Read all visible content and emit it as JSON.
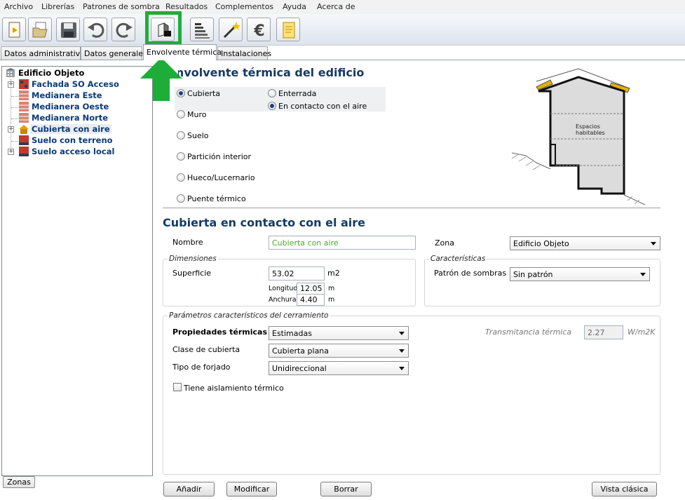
{
  "menu": [
    "Archivo",
    "Librerías",
    "Patrones de sombra",
    "Resultados",
    "Complementos",
    "Ayuda",
    "Acerca de"
  ],
  "toolbar": {
    "buttons": [
      "new-document-icon",
      "open-folder-icon",
      "save-disk-icon",
      "undo-icon",
      "redo-icon",
      "building-envelope-icon",
      "energy-rating-icon",
      "magic-wand-icon",
      "euro-icon",
      "report-icon"
    ],
    "highlight_color": "#1fad3a"
  },
  "tabs": [
    "Datos administrativos",
    "Datos generales",
    "Envolvente térmica",
    "Instalaciones"
  ],
  "tree": {
    "root": "Edificio Objeto",
    "items": [
      {
        "label": "Fachada SO Acceso",
        "icon": "facade-icon",
        "expandable": true
      },
      {
        "label": "Medianera Este",
        "icon": "party-wall-icon",
        "expandable": false
      },
      {
        "label": "Medianera Oeste",
        "icon": "party-wall-icon",
        "expandable": false
      },
      {
        "label": "Medianera Norte",
        "icon": "party-wall-icon",
        "expandable": false
      },
      {
        "label": "Cubierta con aire",
        "icon": "roof-icon",
        "expandable": true
      },
      {
        "label": "Suelo con terreno",
        "icon": "floor-icon",
        "expandable": false
      },
      {
        "label": "Suelo acceso local",
        "icon": "floor-icon",
        "expandable": true
      }
    ],
    "zonas_button": "Zonas"
  },
  "envolvente": {
    "title": "Envolvente térmica del edificio",
    "types": [
      "Cubierta",
      "Muro",
      "Suelo",
      "Partición interior",
      "Hueco/Lucernario",
      "Puente térmico"
    ],
    "selected_type": "Cubierta",
    "subtypes": [
      "Enterrada",
      "En contacto con el aire"
    ],
    "selected_subtype": "En contacto con el aire",
    "diagram_label_1": "Espacios",
    "diagram_label_2": "habitables"
  },
  "detail": {
    "title": "Cubierta en contacto con el aire",
    "nombre_label": "Nombre",
    "nombre_value": "Cubierta con aire",
    "zona_label": "Zona",
    "zona_value": "Edificio Objeto",
    "dimensiones": {
      "title": "Dimensiones",
      "superficie_label": "Superficie",
      "superficie_value": "53.02",
      "superficie_unit": "m2",
      "longitud_label": "Longitud",
      "longitud_value": "12.05",
      "longitud_unit": "m",
      "anchura_label": "Anchura",
      "anchura_value": "4.40",
      "anchura_unit": "m"
    },
    "caracteristicas": {
      "title": "Características",
      "patron_label": "Patrón de sombras",
      "patron_value": "Sin patrón"
    },
    "parametros": {
      "title": "Parámetros característicos del cerramiento",
      "propiedades_label": "Propiedades térmicas",
      "propiedades_value": "Estimadas",
      "clase_label": "Clase de cubierta",
      "clase_value": "Cubierta plana",
      "forjado_label": "Tipo de forjado",
      "forjado_value": "Unidireccional",
      "aislamiento_label": "Tiene aislamiento térmico",
      "transmitancia_label": "Transmitancia térmica",
      "transmitancia_value": "2.27",
      "transmitancia_unit": "W/m2K"
    }
  },
  "buttons": {
    "anadir": "Añadir",
    "modificar": "Modificar",
    "borrar": "Borrar",
    "vista_clasica": "Vista clásica"
  }
}
